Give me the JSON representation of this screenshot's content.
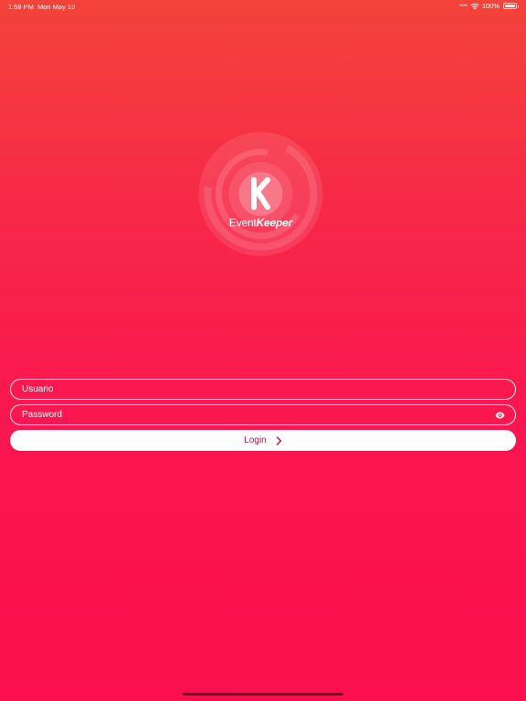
{
  "status_bar": {
    "time": "1:58 PM",
    "date": "Mon May 13",
    "battery": "100%",
    "icons": [
      "signal-dots-icon",
      "wifi-icon",
      "battery-icon"
    ]
  },
  "logo": {
    "brand_regular": "Event",
    "brand_bold": "Keeper",
    "letter": "K"
  },
  "form": {
    "username_placeholder": "Usuario",
    "username_value": "",
    "password_placeholder": "Password",
    "password_value": "",
    "login_label": "Login"
  },
  "colors": {
    "gradient_top": "#f4433a",
    "gradient_bottom": "#fb0f4e",
    "button_text": "#c81240"
  }
}
